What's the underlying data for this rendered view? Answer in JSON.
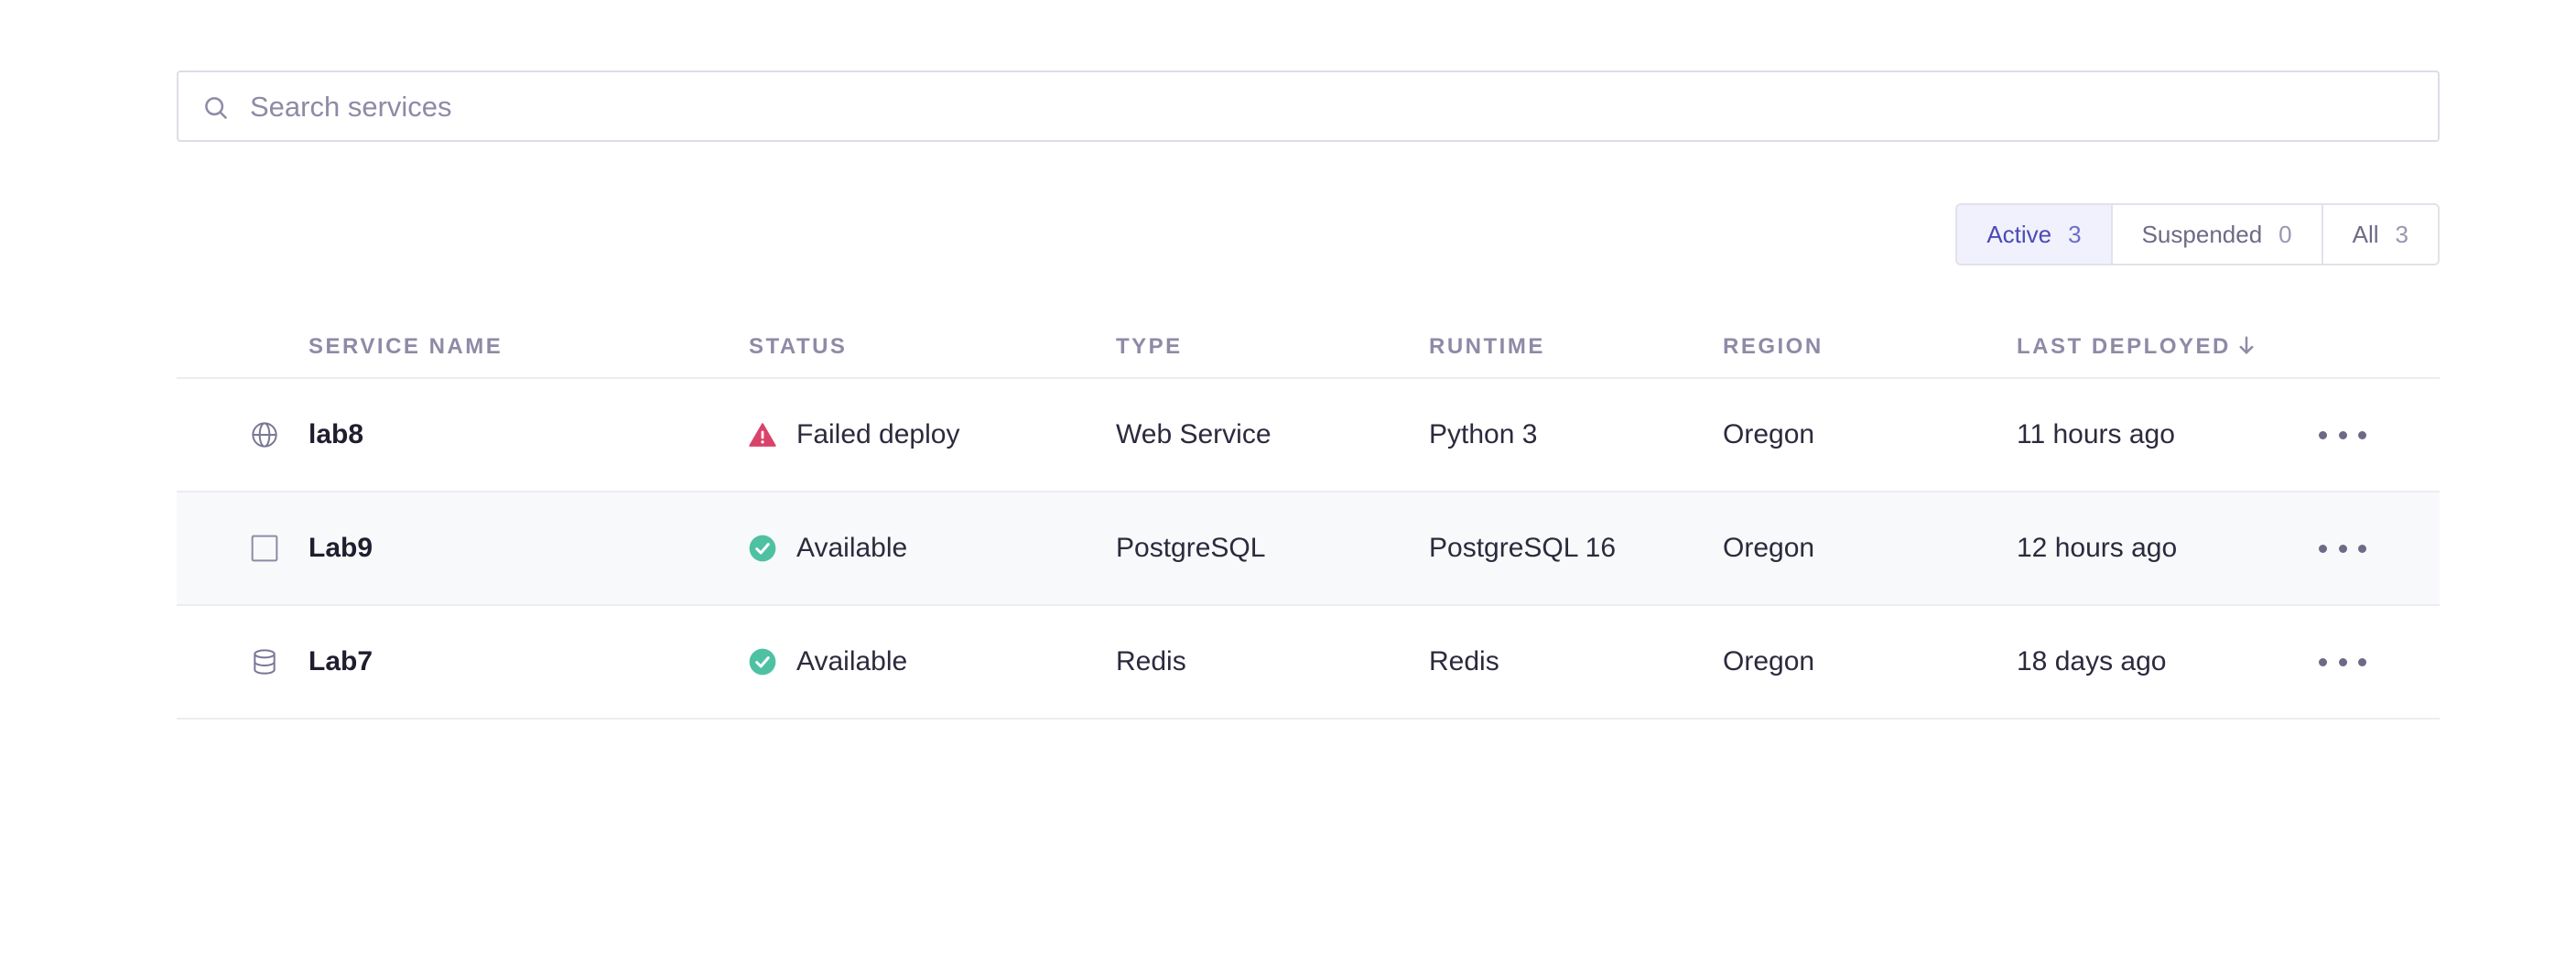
{
  "search": {
    "placeholder": "Search services",
    "value": ""
  },
  "filters": [
    {
      "label": "Active",
      "count": "3",
      "selected": true
    },
    {
      "label": "Suspended",
      "count": "0",
      "selected": false
    },
    {
      "label": "All",
      "count": "3",
      "selected": false
    }
  ],
  "table": {
    "columns": {
      "name": "SERVICE NAME",
      "status": "STATUS",
      "type": "TYPE",
      "runtime": "RUNTIME",
      "region": "REGION",
      "last_deployed": "LAST DEPLOYED",
      "sort": "descending"
    },
    "rows": [
      {
        "icon": "globe-icon",
        "name": "lab8",
        "status": "Failed deploy",
        "status_icon": "warning-icon",
        "type": "Web Service",
        "runtime": "Python 3",
        "region": "Oregon",
        "last_deployed": "11 hours ago"
      },
      {
        "icon": "checkbox-icon",
        "name": "Lab9",
        "status": "Available",
        "status_icon": "check-circle-icon",
        "type": "PostgreSQL",
        "runtime": "PostgreSQL 16",
        "region": "Oregon",
        "last_deployed": "12 hours ago"
      },
      {
        "icon": "database-icon",
        "name": "Lab7",
        "status": "Available",
        "status_icon": "check-circle-icon",
        "type": "Redis",
        "runtime": "Redis",
        "region": "Oregon",
        "last_deployed": "18 days ago"
      }
    ]
  },
  "colors": {
    "accent": "#4b49b5",
    "failed": "#d9436b",
    "available": "#4fc1a3",
    "muted": "#8e8aa6"
  }
}
